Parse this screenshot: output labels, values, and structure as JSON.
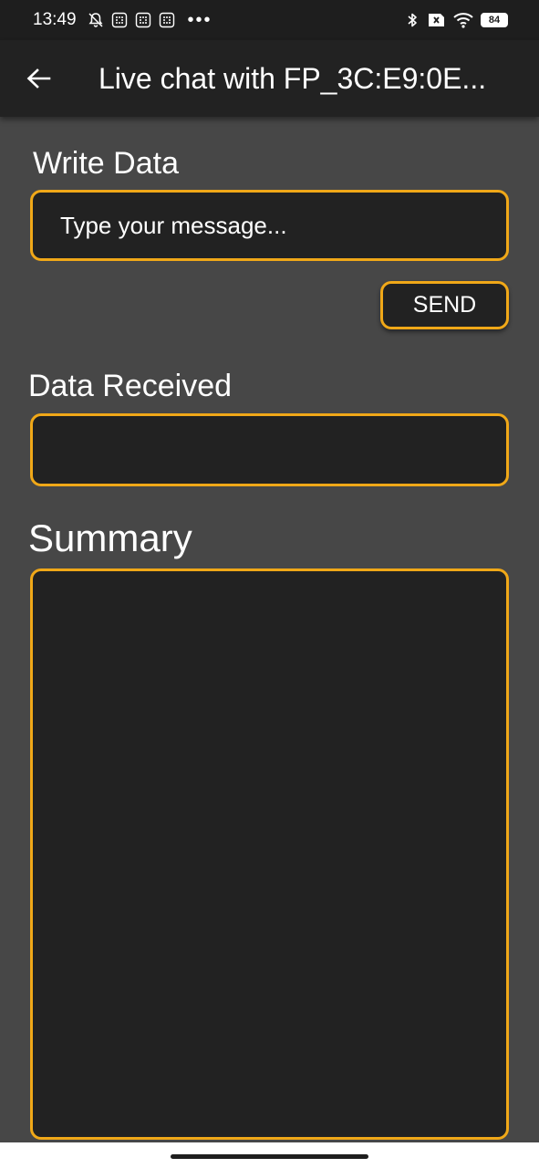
{
  "status_bar": {
    "time": "13:49",
    "dots": "•••",
    "battery": "84"
  },
  "app_bar": {
    "title": "Live chat with FP_3C:E9:0E..."
  },
  "write": {
    "label": "Write Data",
    "placeholder": "Type your message...",
    "value": "",
    "send_label": "SEND"
  },
  "received": {
    "label": "Data Received",
    "value": ""
  },
  "summary": {
    "label": "Summary",
    "value": ""
  },
  "colors": {
    "accent": "#f0a818",
    "background": "#474747",
    "field": "#222222"
  }
}
